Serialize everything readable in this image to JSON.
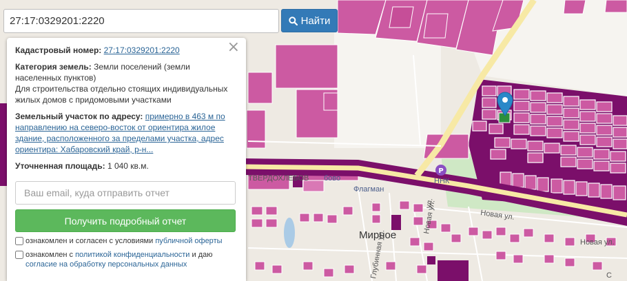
{
  "search": {
    "value": "27:17:0329201:2220",
    "button_label": "Найти",
    "icon": "search-icon"
  },
  "panel": {
    "close_glyph": "×",
    "cadastral_label": "Кадастровый номер:",
    "cadastral_value": "27:17:0329201:2220",
    "category_label": "Категория земель:",
    "category_value": "Земли поселений (земли населенных пунктов)",
    "purpose": "Для строительства отдельно стоящих индивидуальных жилых домов с придомовыми участками",
    "address_label": "Земельный участок по адресу:",
    "address_value": "примерно в 463 м по направлению на северо-восток от ориентира жилое здание, расположенного за пределами участка, адрес ориентира: Хабаровский край, р-н...",
    "area_label": "Уточненная площадь:",
    "area_value": "1 040 кв.м.",
    "email_placeholder": "Ваш email, куда отправить отчет",
    "report_button": "Получить подробный отчет",
    "consent1_prefix": "ознакомлен и согласен с условиями",
    "consent1_link": "публичной оферты",
    "consent2_prefix": "ознакомлен с",
    "consent2_link": "политикой конфиденциальности",
    "consent2_middle": "и даю",
    "consent2_link2": "согласие на обработку персональных данных"
  },
  "map": {
    "labels": {
      "mirnoe": "Мирное",
      "flagman": "Флагман",
      "tverdokhlebovo": "ТВЕРДОХЛЕБОВ",
      "bovo": "бово",
      "nnk": "ННК",
      "novaya_ul_1": "Новая ул.",
      "novaya_ul_2": "Новая ул.",
      "novaya_ul_3": "Новая ул.",
      "glubinnaya": "Глубинная ул.",
      "ul_short": "ул.",
      "corner": "С"
    },
    "colors": {
      "parcel": "#cc5aa2",
      "parcel_border": "#ffffff",
      "district": "#7b0f6a",
      "road_yellow": "#f7e9a5",
      "green": "#cfe8c5",
      "water": "#aacbe6",
      "marker": "#2a88c8"
    },
    "icons": [
      "map-marker-icon",
      "gas-station-icon"
    ]
  }
}
